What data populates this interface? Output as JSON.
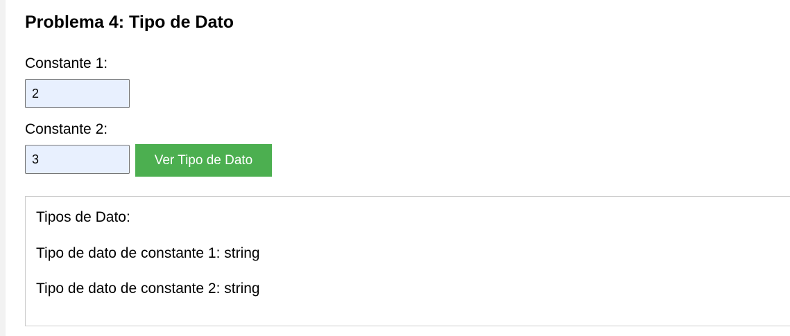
{
  "page": {
    "title": "Problema 4: Tipo de Dato"
  },
  "form": {
    "constant1": {
      "label": "Constante 1:",
      "value": "2"
    },
    "constant2": {
      "label": "Constante 2:",
      "value": "3"
    },
    "submit_label": "Ver Tipo de Dato"
  },
  "result": {
    "heading": "Tipos de Dato:",
    "lines": [
      "Tipo de dato de constante 1: string",
      "Tipo de dato de constante 2: string"
    ]
  },
  "colors": {
    "button_bg": "#4caf50",
    "button_text": "#ffffff",
    "input_bg": "#e8f0fe",
    "page_bg": "#ffffff",
    "side_strip": "#f2f2f2"
  }
}
